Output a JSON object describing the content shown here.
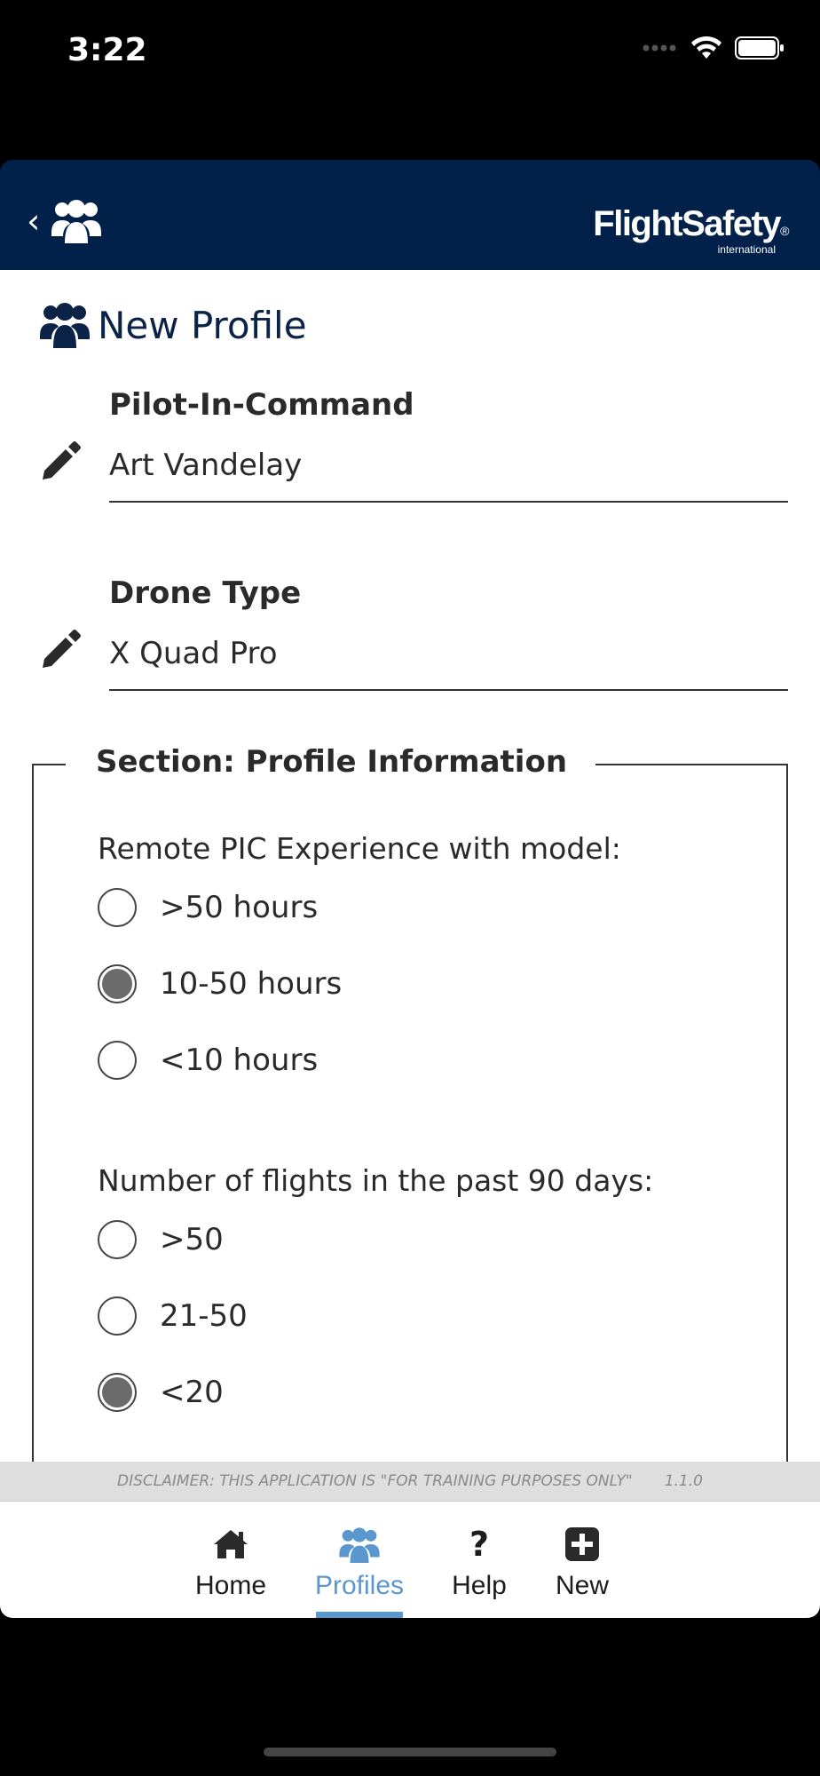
{
  "status_bar": {
    "time": "3:22"
  },
  "header": {
    "brand_main": "FlightSafety",
    "brand_reg": "®",
    "brand_sub": "international"
  },
  "page": {
    "title": "New Profile"
  },
  "fields": [
    {
      "label": "Pilot-In-Command",
      "value": "Art Vandelay"
    },
    {
      "label": "Drone Type",
      "value": "X Quad Pro"
    }
  ],
  "section": {
    "title": "Section: Profile Information",
    "questions": [
      {
        "text": "Remote PIC Experience with model:",
        "options": [
          {
            "label": ">50 hours",
            "checked": false
          },
          {
            "label": "10-50 hours",
            "checked": true
          },
          {
            "label": "<10 hours",
            "checked": false
          }
        ]
      },
      {
        "text": "Number of flights in the past 90 days:",
        "options": [
          {
            "label": ">50",
            "checked": false
          },
          {
            "label": "21-50",
            "checked": false
          },
          {
            "label": "<20",
            "checked": true
          }
        ]
      }
    ]
  },
  "footer": {
    "disclaimer": "DISCLAIMER: THIS APPLICATION IS \"FOR TRAINING PURPOSES ONLY\"",
    "version": "1.1.0"
  },
  "tabs": [
    {
      "label": "Home",
      "icon": "home-icon",
      "active": false
    },
    {
      "label": "Profiles",
      "icon": "users-icon",
      "active": true
    },
    {
      "label": "Help",
      "icon": "question-icon",
      "active": false
    },
    {
      "label": "New",
      "icon": "plus-square-icon",
      "active": false
    }
  ],
  "colors": {
    "header_bg": "#02214a",
    "accent": "#5b97cf",
    "radio_fill": "#6b6b6b",
    "disclaimer_bg": "#dedede"
  }
}
